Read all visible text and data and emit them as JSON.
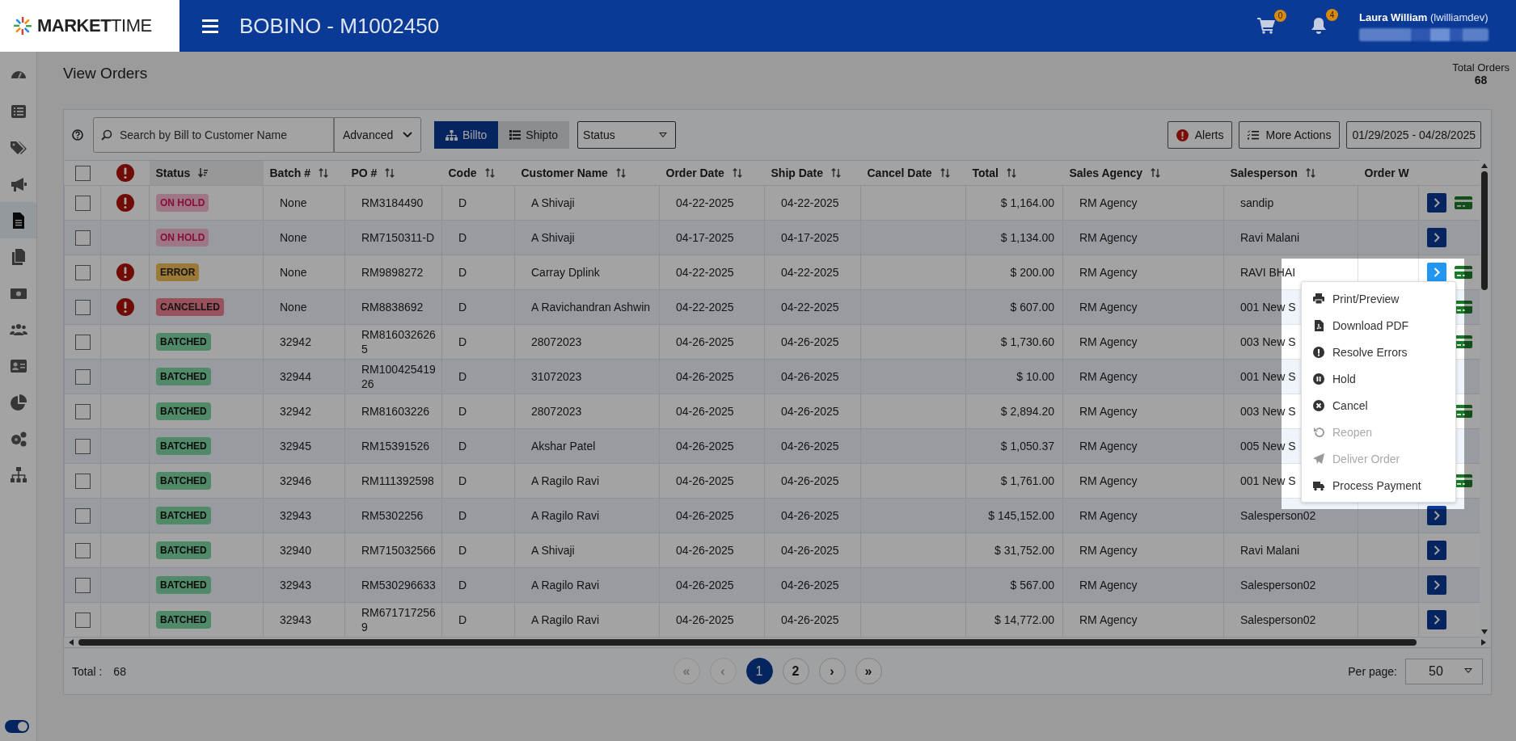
{
  "header": {
    "logo": "**MARKET**TIME",
    "title": "BOBINO - M1002450",
    "cart_count": "0",
    "notification_count": "4",
    "user_name": "Laura William",
    "user_login": "(lwilliamdev)"
  },
  "sidebar": {
    "items": [
      {
        "selected": false
      },
      {
        "selected": false
      },
      {
        "selected": false
      },
      {
        "selected": false
      },
      {
        "selected": true
      },
      {
        "selected": false
      },
      {
        "selected": false
      },
      {
        "selected": false
      },
      {
        "selected": false
      },
      {
        "selected": false
      },
      {
        "selected": false
      },
      {
        "selected": false
      }
    ],
    "toggle_on": true
  },
  "page": {
    "title": "View Orders",
    "total_label": "Total Orders",
    "total_value": "68"
  },
  "toolbar": {
    "search_placeholder": "Search by Bill to Customer Name",
    "advanced": "Advanced",
    "view_toggle": [
      {
        "label": "Billto",
        "selected": true
      },
      {
        "label": "Shipto",
        "selected": false
      }
    ],
    "status_select": "Status",
    "alerts": "Alerts",
    "more_actions": "More Actions",
    "date_range": "01/29/2025 - 04/28/2025"
  },
  "table": {
    "columns": [
      {
        "kind": "checkbox",
        "checked": false
      },
      {
        "kind": "alert"
      },
      {
        "kind": "text",
        "label": "Status",
        "sortable": true,
        "sorted": true
      },
      {
        "kind": "text",
        "label": "Batch #",
        "sortable": true,
        "sorted": false
      },
      {
        "kind": "text",
        "label": "PO #",
        "sortable": true,
        "sorted": false
      },
      {
        "kind": "text",
        "label": "Code",
        "sortable": true,
        "sorted": false
      },
      {
        "kind": "text",
        "label": "Customer Name",
        "sortable": true,
        "sorted": false
      },
      {
        "kind": "text",
        "label": "Order Date",
        "sortable": true,
        "sorted": false
      },
      {
        "kind": "text",
        "label": "Ship Date",
        "sortable": true,
        "sorted": false
      },
      {
        "kind": "text",
        "label": "Cancel Date",
        "sortable": true,
        "sorted": false
      },
      {
        "kind": "text",
        "label": "Total",
        "sortable": true,
        "sorted": false
      },
      {
        "kind": "text",
        "label": "Sales Agency",
        "sortable": true,
        "sorted": false
      },
      {
        "kind": "text",
        "label": "Salesperson",
        "sortable": true,
        "sorted": false
      },
      {
        "kind": "text",
        "label": "Order W"
      },
      {
        "kind": "actions"
      }
    ],
    "rows": [
      {
        "checked": false,
        "alert": true,
        "status": {
          "label": "ON HOLD",
          "kind": "hold"
        },
        "batch": "None",
        "po": "RM3184490",
        "code": "D",
        "customer": "A Shivaji",
        "order_date": "04-22-2025",
        "ship_date": "04-22-2025",
        "total": "$ 1,164.00",
        "agency": "RM Agency",
        "salesperson": "sandip",
        "open_button": true,
        "menu_open": false,
        "payment": true
      },
      {
        "checked": false,
        "alert": false,
        "status": {
          "label": "ON HOLD",
          "kind": "hold"
        },
        "batch": "None",
        "po": "RM7150311-D",
        "code": "D",
        "customer": "A Shivaji",
        "order_date": "04-17-2025",
        "ship_date": "04-17-2025",
        "total": "$ 1,134.00",
        "agency": "RM Agency",
        "salesperson": "Ravi Malani",
        "open_button": true,
        "menu_open": false,
        "payment": false
      },
      {
        "checked": false,
        "alert": true,
        "status": {
          "label": "ERROR",
          "kind": "error"
        },
        "batch": "None",
        "po": "RM9898272",
        "code": "D",
        "customer": "Carray Dplink",
        "order_date": "04-22-2025",
        "ship_date": "04-22-2025",
        "total": "$ 200.00",
        "agency": "RM Agency",
        "salesperson": "RAVI BHAI",
        "open_button": true,
        "menu_open": true,
        "payment": true
      },
      {
        "checked": false,
        "alert": true,
        "status": {
          "label": "CANCELLED",
          "kind": "cancelled"
        },
        "batch": "None",
        "po": "RM8838692",
        "code": "D",
        "customer": "A Ravichandran Ashwin",
        "order_date": "04-22-2025",
        "ship_date": "04-22-2025",
        "total": "$ 607.00",
        "agency": "RM Agency",
        "salesperson": "001 New S",
        "payment": true
      },
      {
        "checked": false,
        "alert": false,
        "status": {
          "label": "BATCHED",
          "kind": "batched"
        },
        "batch": "32942",
        "po": "RM8160326265",
        "code": "D",
        "customer": "28072023",
        "order_date": "04-26-2025",
        "ship_date": "04-26-2025",
        "total": "$ 1,730.60",
        "agency": "RM Agency",
        "salesperson": "003 New S",
        "payment": true
      },
      {
        "checked": false,
        "alert": false,
        "status": {
          "label": "BATCHED",
          "kind": "batched"
        },
        "batch": "32944",
        "po": "RM10042541926",
        "code": "D",
        "customer": "31072023",
        "order_date": "04-26-2025",
        "ship_date": "04-26-2025",
        "total": "$ 10.00",
        "agency": "RM Agency",
        "salesperson": "001 New S",
        "payment": false
      },
      {
        "checked": false,
        "alert": false,
        "status": {
          "label": "BATCHED",
          "kind": "batched"
        },
        "batch": "32942",
        "po": "RM81603226",
        "code": "D",
        "customer": "28072023",
        "order_date": "04-26-2025",
        "ship_date": "04-26-2025",
        "total": "$ 2,894.20",
        "agency": "RM Agency",
        "salesperson": "003 New S",
        "payment": true
      },
      {
        "checked": false,
        "alert": false,
        "status": {
          "label": "BATCHED",
          "kind": "batched"
        },
        "batch": "32945",
        "po": "RM15391526",
        "code": "D",
        "customer": "Akshar Patel",
        "order_date": "04-26-2025",
        "ship_date": "04-26-2025",
        "total": "$ 1,050.37",
        "agency": "RM Agency",
        "salesperson": "005 New S",
        "payment": false
      },
      {
        "checked": false,
        "alert": false,
        "status": {
          "label": "BATCHED",
          "kind": "batched"
        },
        "batch": "32946",
        "po": "RM111392598",
        "code": "D",
        "customer": "A Ragilo Ravi",
        "order_date": "04-26-2025",
        "ship_date": "04-26-2025",
        "total": "$ 1,761.00",
        "agency": "RM Agency",
        "salesperson": "001 New S",
        "payment": true
      },
      {
        "checked": false,
        "alert": false,
        "status": {
          "label": "BATCHED",
          "kind": "batched"
        },
        "batch": "32943",
        "po": "RM5302256",
        "code": "D",
        "customer": "A Ragilo Ravi",
        "order_date": "04-26-2025",
        "ship_date": "04-26-2025",
        "total": "$ 145,152.00",
        "agency": "RM Agency",
        "salesperson": "Salesperson02",
        "open_button": true,
        "menu_open": false,
        "payment": false
      },
      {
        "checked": false,
        "alert": false,
        "status": {
          "label": "BATCHED",
          "kind": "batched"
        },
        "batch": "32940",
        "po": "RM715032566",
        "code": "D",
        "customer": "A Shivaji",
        "order_date": "04-26-2025",
        "ship_date": "04-26-2025",
        "total": "$ 31,752.00",
        "agency": "RM Agency",
        "salesperson": "Ravi Malani",
        "open_button": true,
        "menu_open": false,
        "payment": false
      },
      {
        "checked": false,
        "alert": false,
        "status": {
          "label": "BATCHED",
          "kind": "batched"
        },
        "batch": "32943",
        "po": "RM530296633",
        "code": "D",
        "customer": "A Ragilo Ravi",
        "order_date": "04-26-2025",
        "ship_date": "04-26-2025",
        "total": "$ 567.00",
        "agency": "RM Agency",
        "salesperson": "Salesperson02",
        "open_button": true,
        "menu_open": false,
        "payment": false
      },
      {
        "checked": false,
        "alert": false,
        "status": {
          "label": "BATCHED",
          "kind": "batched"
        },
        "batch": "32943",
        "po": "RM6717172569",
        "code": "D",
        "customer": "A Ragilo Ravi",
        "order_date": "04-26-2025",
        "ship_date": "04-26-2025",
        "total": "$ 14,772.00",
        "agency": "RM Agency",
        "salesperson": "Salesperson02",
        "open_button": true,
        "menu_open": false,
        "payment": false
      }
    ]
  },
  "action_menu": {
    "items": [
      {
        "label": "Print/Preview",
        "kind": "print",
        "disabled": false
      },
      {
        "label": "Download PDF",
        "kind": "pdf",
        "disabled": false
      },
      {
        "label": "Resolve Errors",
        "kind": "resolve",
        "disabled": false
      },
      {
        "label": "Hold",
        "kind": "hold",
        "disabled": false
      },
      {
        "label": "Cancel",
        "kind": "cancel",
        "disabled": false
      },
      {
        "label": "Reopen",
        "kind": "reopen",
        "disabled": true
      },
      {
        "label": "Deliver Order",
        "kind": "deliver",
        "disabled": true
      },
      {
        "label": "Process Payment",
        "kind": "payment",
        "disabled": false
      }
    ]
  },
  "footer": {
    "total_label": "Total :",
    "total_value": "68",
    "pages": [
      {
        "label": "«",
        "selected": false,
        "disabled": true
      },
      {
        "label": "‹",
        "selected": false,
        "disabled": true
      },
      {
        "label": "1",
        "selected": true,
        "disabled": false
      },
      {
        "label": "2",
        "selected": false,
        "disabled": false
      },
      {
        "label": "›",
        "selected": false,
        "disabled": false
      },
      {
        "label": "»",
        "selected": false,
        "disabled": false
      }
    ],
    "per_page_label": "Per page:",
    "per_page": "50"
  }
}
